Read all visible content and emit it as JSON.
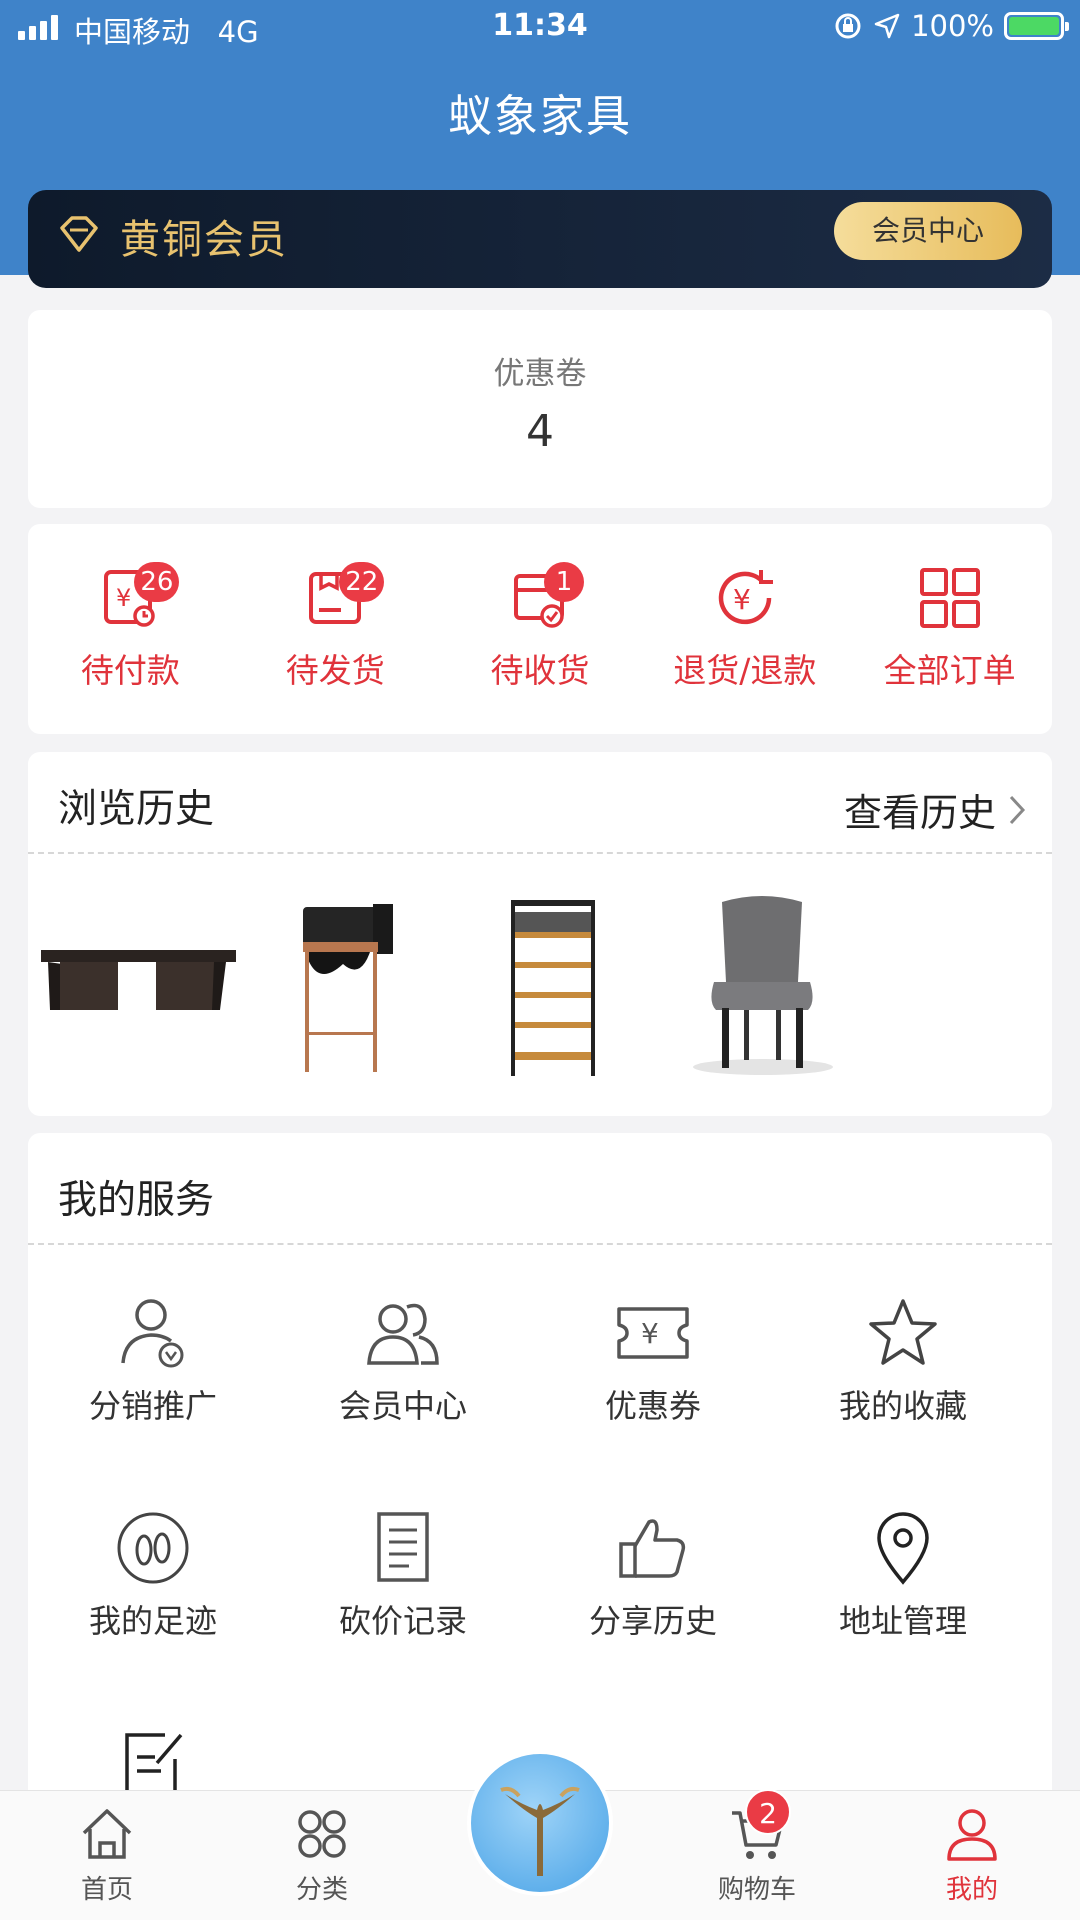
{
  "status_bar": {
    "carrier": "中国移动",
    "network": "4G",
    "time": "11:34",
    "battery": "100%"
  },
  "app_title": "蚁象家具",
  "member": {
    "level": "黄铜会员",
    "center_button": "会员中心"
  },
  "coupon": {
    "label": "优惠卷",
    "count": "4"
  },
  "orders": [
    {
      "label": "待付款",
      "badge": "26",
      "icon": "wallet-clock-icon"
    },
    {
      "label": "待发货",
      "badge": "22",
      "icon": "package-icon"
    },
    {
      "label": "待收货",
      "badge": "1",
      "icon": "box-check-icon"
    },
    {
      "label": "退货/退款",
      "badge": "",
      "icon": "refund-icon"
    },
    {
      "label": "全部订单",
      "badge": "",
      "icon": "grid-icon"
    }
  ],
  "history": {
    "title": "浏览历史",
    "link": "查看历史"
  },
  "services": {
    "title": "我的服务",
    "items": [
      {
        "label": "分销推广",
        "icon": "user-badge-icon"
      },
      {
        "label": "会员中心",
        "icon": "users-icon"
      },
      {
        "label": "优惠券",
        "icon": "ticket-icon"
      },
      {
        "label": "我的收藏",
        "icon": "star-icon"
      },
      {
        "label": "我的足迹",
        "icon": "footprint-icon"
      },
      {
        "label": "砍价记录",
        "icon": "document-icon"
      },
      {
        "label": "分享历史",
        "icon": "thumbs-up-icon"
      },
      {
        "label": "地址管理",
        "icon": "location-pin-icon"
      },
      {
        "label": "",
        "icon": "edit-note-icon"
      }
    ]
  },
  "tabbar": [
    {
      "label": "首页",
      "icon": "home-icon"
    },
    {
      "label": "分类",
      "icon": "category-icon"
    },
    {
      "label": "购物车",
      "icon": "cart-icon",
      "badge": "2"
    },
    {
      "label": "我的",
      "icon": "user-icon",
      "active": true
    }
  ],
  "colors": {
    "header_blue": "#3f83c9",
    "accent_red": "#e0333b",
    "member_gold": "#e8c26f"
  }
}
